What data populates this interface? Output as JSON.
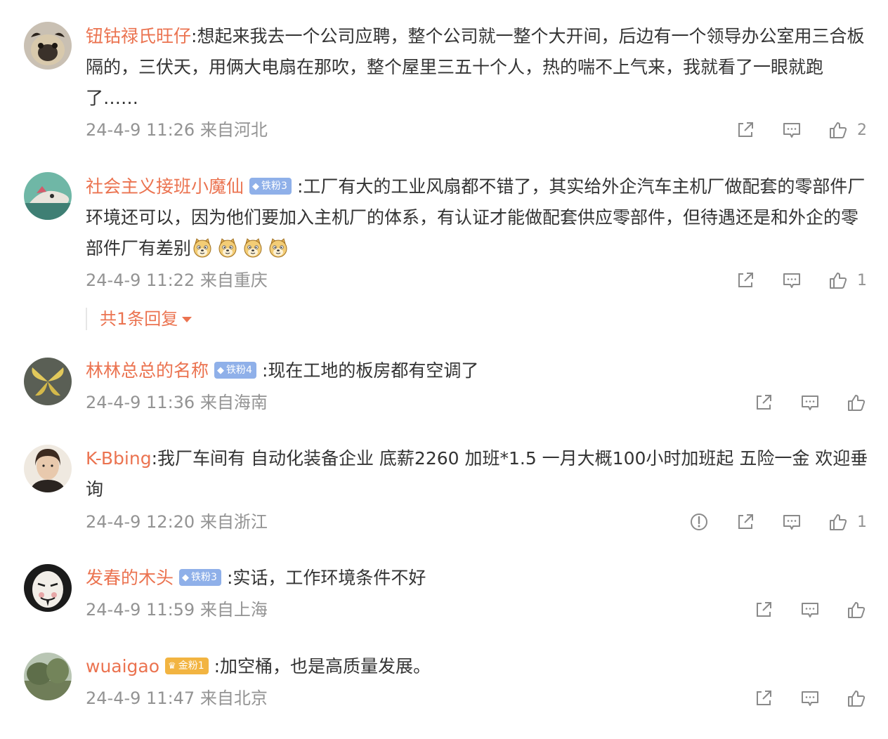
{
  "comments": [
    {
      "username": "钮钴禄氏旺仔",
      "badge": "",
      "text": ":想起来我去一个公司应聘，整个公司就一整个大开间，后边有一个领导办公室用三合板隔的，三伏天，用俩大电扇在那吹，整个屋里三五十个人，热的喘不上气来，我就看了一眼就跑了……",
      "time": "24-4-9 11:26 来自河北",
      "likes": "2",
      "avatar_icon": "pug-avatar"
    },
    {
      "username": "社会主义接班小魔仙",
      "badge": "铁粉3",
      "text": ":工厂有大的工业风扇都不错了，其实给外企汽车主机厂做配套的零部件厂环境还可以，因为他们要加入主机厂的体系，有认证才能做配套供应零部件，但待遇还是和外企的零部件厂有差别",
      "time": "24-4-9 11:22 来自重庆",
      "likes": "1",
      "replies": "共1条回复",
      "avatar_icon": "cartoon-avatar"
    },
    {
      "username": "林林总总的名称",
      "badge": "铁粉4",
      "text": ":现在工地的板房都有空调了",
      "time": "24-4-9 11:36 来自海南",
      "likes": "",
      "avatar_icon": "butterfly-avatar"
    },
    {
      "username": "K-Bbing",
      "badge": "",
      "text": ":我厂车间有 自动化装备企业 底薪2260 加班*1.5 一月大概100小时加班起 五险一金  欢迎垂询",
      "time": "24-4-9 12:20 来自浙江",
      "likes": "1",
      "avatar_icon": "portrait-avatar"
    },
    {
      "username": "发春的木头",
      "badge": "铁粉3",
      "text": ":实话，工作环境条件不好",
      "time": "24-4-9 11:59 来自上海",
      "likes": "",
      "avatar_icon": "mask-avatar"
    },
    {
      "username": "wuaigao",
      "badge": "金粉1",
      "text": ":加空桶，也是高质量发展。",
      "time": "24-4-9 11:47 来自北京",
      "likes": "",
      "avatar_icon": "landscape-avatar"
    }
  ],
  "icons": [
    "share-icon",
    "comment-icon",
    "like-icon",
    "report-icon",
    "doge-emoji"
  ],
  "colors": {
    "username": "#eb7350",
    "meta": "#939393",
    "badge_iron": "#8fb0e9",
    "badge_gold": "#f2b441"
  }
}
